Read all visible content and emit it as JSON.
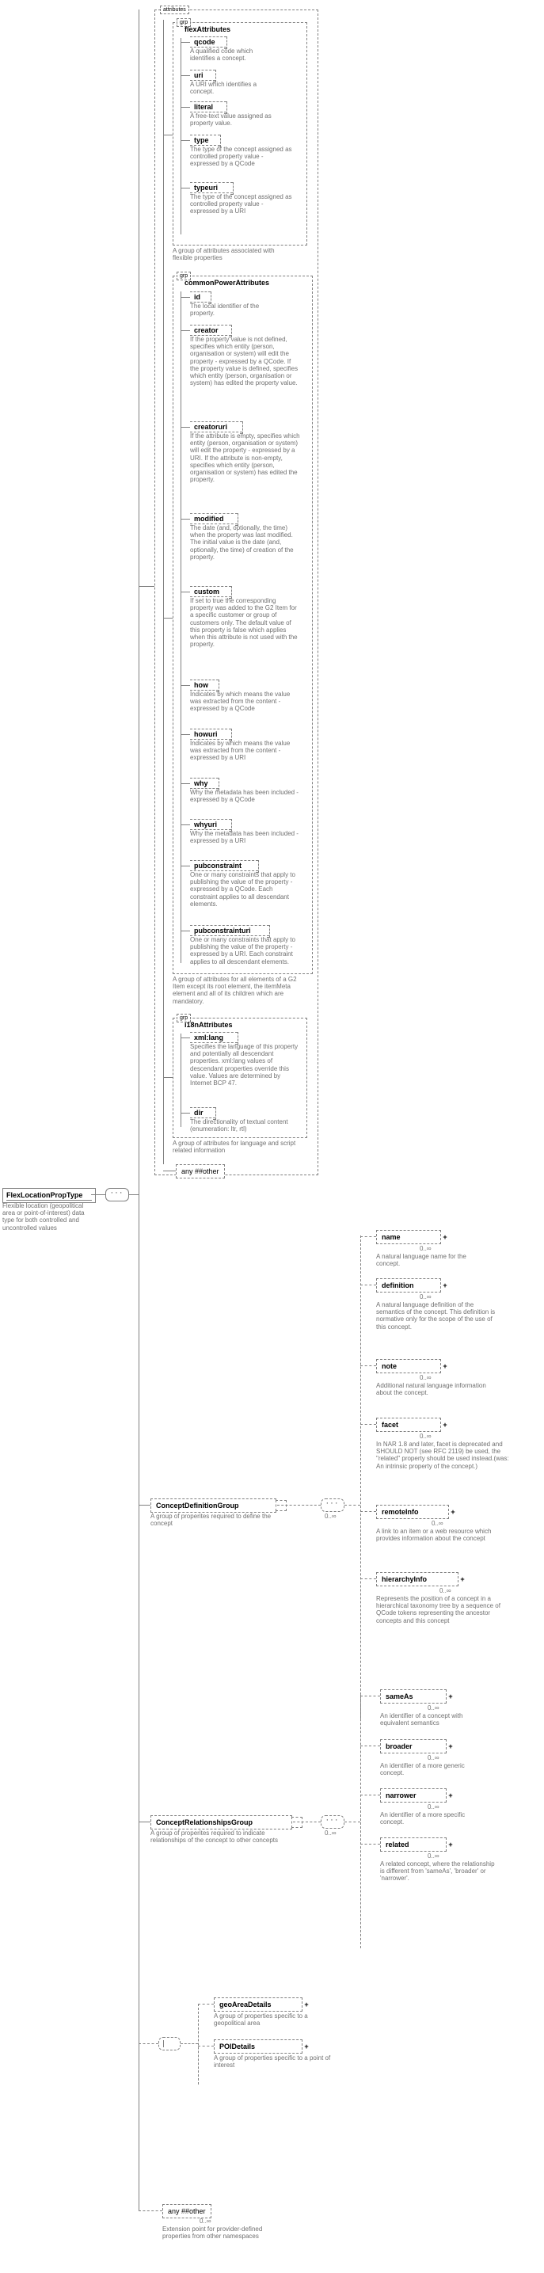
{
  "root": {
    "title": "FlexLocationPropType",
    "desc": "Flexible location (geopolitical area or point-of-interest) data type for both controlled and uncontrolled values"
  },
  "outer_attr_tab": "attributes",
  "flex": {
    "tab": "grp",
    "title": "flexAttributes",
    "attrs": [
      {
        "name": "qcode",
        "desc": "A qualified code which identifies a concept."
      },
      {
        "name": "uri",
        "desc": "A URI which identifies a concept."
      },
      {
        "name": "literal",
        "desc": "A free-text value assigned as property value."
      },
      {
        "name": "type",
        "desc": "The type of the concept assigned as controlled property value - expressed by a QCode"
      },
      {
        "name": "typeuri",
        "desc": "The type of the concept assigned as controlled property value - expressed by a URI"
      }
    ],
    "desc": "A group of attributes associated with flexible properties"
  },
  "common": {
    "tab": "grp",
    "title": "commonPowerAttributes",
    "attrs": [
      {
        "name": "id",
        "desc": "The local identifier of the property."
      },
      {
        "name": "creator",
        "desc": "If the property value is not defined, specifies which entity (person, organisation or system) will edit the property - expressed by a QCode. If the property value is defined, specifies which entity (person, organisation or system) has edited the property value."
      },
      {
        "name": "creatoruri",
        "desc": "If the attribute is empty, specifies which entity (person, organisation or system) will edit the property - expressed by a URI. If the attribute is non-empty, specifies which entity (person, organisation or system) has edited the property."
      },
      {
        "name": "modified",
        "desc": "The date (and, optionally, the time) when the property was last modified. The initial value is the date (and, optionally, the time) of creation of the property."
      },
      {
        "name": "custom",
        "desc": "If set to true the corresponding property was added to the G2 Item for a specific customer or group of customers only. The default value of this property is false which applies when this attribute is not used with the property."
      },
      {
        "name": "how",
        "desc": "Indicates by which means the value was extracted from the content - expressed by a QCode"
      },
      {
        "name": "howuri",
        "desc": "Indicates by which means the value was extracted from the content - expressed by a URI"
      },
      {
        "name": "why",
        "desc": "Why the metadata has been included - expressed by a QCode"
      },
      {
        "name": "whyuri",
        "desc": "Why the metadata has been included - expressed by a URI"
      },
      {
        "name": "pubconstraint",
        "desc": "One or many constraints that apply to publishing the value of the property - expressed by a QCode. Each constraint applies to all descendant elements."
      },
      {
        "name": "pubconstrainturi",
        "desc": "One or many constraints that apply to publishing the value of the property - expressed by a URI. Each constraint applies to all descendant elements."
      }
    ],
    "desc": "A group of attributes for all elements of a G2 Item except its root element, the itemMeta element and all of its children which are mandatory."
  },
  "i18n": {
    "tab": "grp",
    "title": "i18nAttributes",
    "attrs": [
      {
        "name": "xml:lang",
        "desc": "Specifies the language of this property and potentially all descendant properties. xml:lang values of descendant properties override this value. Values are determined by Internet BCP 47."
      },
      {
        "name": "dir",
        "desc": "The directionality of textual content (enumeration: ltr, rtl)"
      }
    ],
    "desc": "A group of attributes for language and script related information"
  },
  "anyAttr": {
    "label": "any ##other"
  },
  "cdg": {
    "title": "ConceptDefinitionGroup",
    "desc": "A group of properites required to define the concept",
    "children": [
      {
        "name": "name",
        "card": "0..∞",
        "desc": "A natural language name for the concept."
      },
      {
        "name": "definition",
        "card": "0..∞",
        "desc": "A natural language definition of the semantics of the concept. This definition is normative only for the scope of the use of this concept."
      },
      {
        "name": "note",
        "card": "0..∞",
        "desc": "Additional natural language information about the concept."
      },
      {
        "name": "facet",
        "card": "0..∞",
        "desc": "In NAR 1.8 and later, facet is deprecated and SHOULD NOT (see RFC 2119) be used, the \"related\" property should be used instead.(was: An intrinsic property of the concept.)"
      },
      {
        "name": "remoteInfo",
        "card": "0..∞",
        "desc": "A link to an item or a web resource which provides information about the concept"
      },
      {
        "name": "hierarchyInfo",
        "card": "0..∞",
        "desc": "Represents the position of a concept in a hierarchical taxonomy tree by a sequence of QCode tokens representing the ancestor concepts and this concept"
      }
    ]
  },
  "crg": {
    "title": "ConceptRelationshipsGroup",
    "desc": "A group of properites required to indicate relationships of the concept to other concepts",
    "children": [
      {
        "name": "sameAs",
        "card": "0..∞",
        "desc": "An identifier of a concept with equivalent semantics"
      },
      {
        "name": "broader",
        "card": "0..∞",
        "desc": "An identifier of a more generic concept."
      },
      {
        "name": "narrower",
        "card": "0..∞",
        "desc": "An identifier of a more specific concept."
      },
      {
        "name": "related",
        "card": "0..∞",
        "desc": "A related concept, where the relationship is different from 'sameAs', 'broader' or 'narrower'."
      }
    ]
  },
  "choice": {
    "children": [
      {
        "name": "geoAreaDetails",
        "desc": "A group of properties specific to a geopolitical area"
      },
      {
        "name": "POIDetails",
        "desc": "A group of properties specific to a point of interest"
      }
    ]
  },
  "anyChild": {
    "label": "any ##other",
    "card": "0..∞",
    "desc": "Extension point for provider-defined properties from other namespaces"
  }
}
